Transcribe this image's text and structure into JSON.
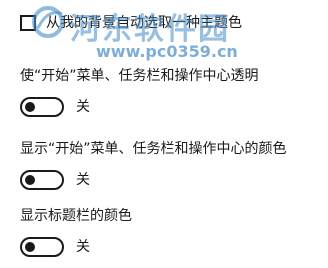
{
  "accent_checkbox": {
    "label": "从我的背景自动选取一种主题色",
    "checked": false
  },
  "settings": [
    {
      "title": "使“开始”菜单、任务栏和操作中心透明",
      "state_label": "关",
      "on": false
    },
    {
      "title": "显示“开始”菜单、任务栏和操作中心的颜色",
      "state_label": "关",
      "on": false
    },
    {
      "title": "显示标题栏的颜色",
      "state_label": "关",
      "on": false
    }
  ],
  "watermark": {
    "title": "河东软件园",
    "url": "www.pc0359.cn",
    "color": "#468cc8"
  },
  "colors": {
    "background": "#ffffff",
    "text": "#1a1a1a"
  }
}
